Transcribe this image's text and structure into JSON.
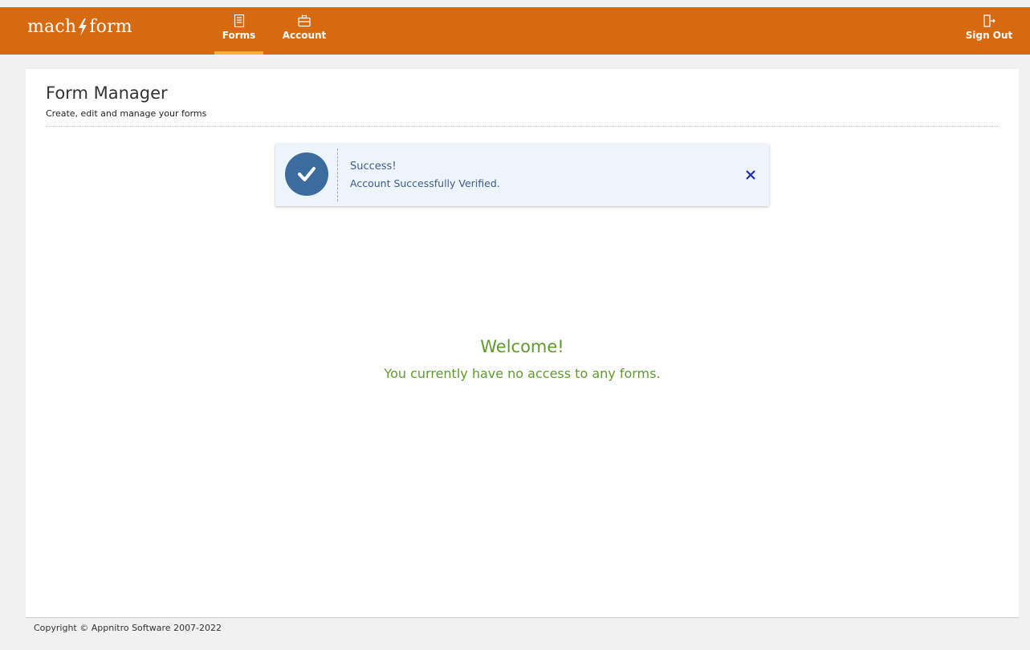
{
  "header": {
    "logo_left": "mach",
    "logo_right": "form",
    "nav": [
      {
        "label": "Forms",
        "icon": "forms-icon",
        "active": true
      },
      {
        "label": "Account",
        "icon": "briefcase-icon",
        "active": false
      }
    ],
    "sign_out_label": "Sign Out",
    "colors": {
      "bar": "#d66a10",
      "active_underline": "#f3b23a"
    }
  },
  "page": {
    "title": "Form Manager",
    "subtitle": "Create, edit and manage your forms"
  },
  "alert": {
    "title": "Success!",
    "message": "Account Successfully Verified.",
    "icon": "check-circle-icon",
    "close_icon": "close-icon",
    "color": "#3c6b9e"
  },
  "welcome": {
    "title": "Welcome!",
    "message": "You currently have no access to any forms.",
    "color": "#5e9a2e"
  },
  "footer": {
    "copyright": "Copyright © Appnitro Software 2007-2022"
  }
}
